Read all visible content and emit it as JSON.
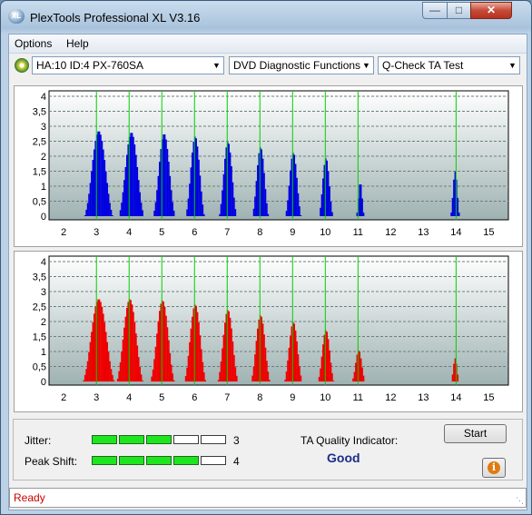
{
  "window": {
    "title": "PlexTools Professional XL V3.16",
    "icon_text": "XL"
  },
  "menu": [
    "Options",
    "Help"
  ],
  "toolbar": {
    "drive": "HA:10 ID:4  PX-760SA",
    "function": "DVD Diagnostic Functions",
    "test": "Q-Check TA Test"
  },
  "chart_data": [
    {
      "type": "bar",
      "series_color": "#0000e0",
      "ylim": [
        0,
        4
      ],
      "y_ticks": [
        "4",
        "3,5",
        "3",
        "2,5",
        "2",
        "1,5",
        "1",
        "0,5",
        "0"
      ],
      "x_ticks": [
        "2",
        "3",
        "4",
        "5",
        "6",
        "7",
        "8",
        "9",
        "10",
        "11",
        "12",
        "13",
        "14",
        "15"
      ],
      "peaks": [
        {
          "x": 3,
          "center": 3.05,
          "height": 3.1,
          "width": 0.45
        },
        {
          "x": 4,
          "center": 4.05,
          "height": 3.05,
          "width": 0.4
        },
        {
          "x": 5,
          "center": 5.05,
          "height": 3.0,
          "width": 0.35
        },
        {
          "x": 6,
          "center": 6.0,
          "height": 2.9,
          "width": 0.3
        },
        {
          "x": 7,
          "center": 7.0,
          "height": 2.7,
          "width": 0.28
        },
        {
          "x": 8,
          "center": 8.0,
          "height": 2.5,
          "width": 0.26
        },
        {
          "x": 9,
          "center": 9.0,
          "height": 2.3,
          "width": 0.25
        },
        {
          "x": 10,
          "center": 10.0,
          "height": 2.1,
          "width": 0.22
        },
        {
          "x": 11,
          "center": 11.05,
          "height": 1.2,
          "width": 0.12
        },
        {
          "x": 14,
          "center": 13.95,
          "height": 1.6,
          "width": 0.14
        }
      ]
    },
    {
      "type": "bar",
      "series_color": "#ee0000",
      "ylim": [
        0,
        4
      ],
      "y_ticks": [
        "4",
        "3,5",
        "3",
        "2,5",
        "2",
        "1,5",
        "1",
        "0,5",
        "0"
      ],
      "x_ticks": [
        "2",
        "3",
        "4",
        "5",
        "6",
        "7",
        "8",
        "9",
        "10",
        "11",
        "12",
        "13",
        "14",
        "15"
      ],
      "peaks": [
        {
          "x": 3,
          "center": 3.05,
          "height": 3.0,
          "width": 0.5
        },
        {
          "x": 4,
          "center": 4.0,
          "height": 3.0,
          "width": 0.42
        },
        {
          "x": 5,
          "center": 5.0,
          "height": 2.95,
          "width": 0.38
        },
        {
          "x": 6,
          "center": 6.0,
          "height": 2.8,
          "width": 0.34
        },
        {
          "x": 7,
          "center": 7.0,
          "height": 2.6,
          "width": 0.32
        },
        {
          "x": 8,
          "center": 8.0,
          "height": 2.4,
          "width": 0.3
        },
        {
          "x": 9,
          "center": 9.0,
          "height": 2.15,
          "width": 0.28
        },
        {
          "x": 10,
          "center": 10.0,
          "height": 1.85,
          "width": 0.25
        },
        {
          "x": 11,
          "center": 11.0,
          "height": 1.1,
          "width": 0.2
        },
        {
          "x": 14,
          "center": 13.95,
          "height": 0.8,
          "width": 0.12
        }
      ]
    }
  ],
  "metrics": {
    "jitter": {
      "label": "Jitter:",
      "value": "3",
      "filled": 3,
      "segments": 5
    },
    "peak_shift": {
      "label": "Peak Shift:",
      "value": "4",
      "filled": 4,
      "segments": 5
    }
  },
  "ta_quality": {
    "label": "TA Quality Indicator:",
    "value": "Good"
  },
  "buttons": {
    "start": "Start",
    "info_icon": "i"
  },
  "status": "Ready",
  "colors": {
    "plot_bg_top": "#ffffff",
    "plot_bg_bottom": "#9fb2b2",
    "marker_line": "#00d000"
  }
}
